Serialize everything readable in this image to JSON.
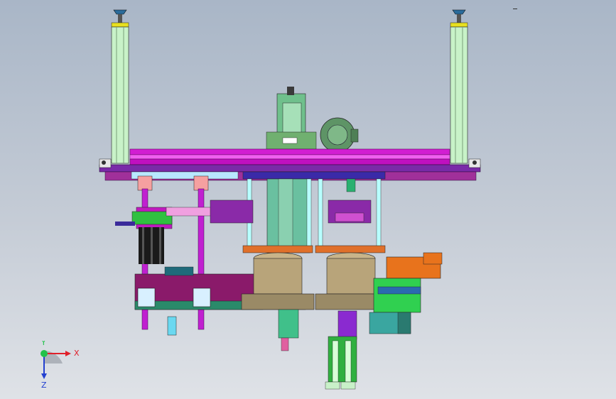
{
  "viewport": {
    "background_top": "#a9b6c7",
    "background_bottom": "#dfe2e7"
  },
  "triad": {
    "x_label": "X",
    "y_label": "Y",
    "z_label": "Z",
    "x_color": "#e0202a",
    "y_color": "#22c24a",
    "z_color": "#2340d0"
  },
  "colors": {
    "frame_magenta": "#d21ed2",
    "column_green": "#c8f2c8",
    "plate_purple": "#7a2aa8",
    "bronze_wheel": "#b8a47a",
    "orange_block": "#e8731c",
    "teal_block": "#3aa6a0"
  }
}
